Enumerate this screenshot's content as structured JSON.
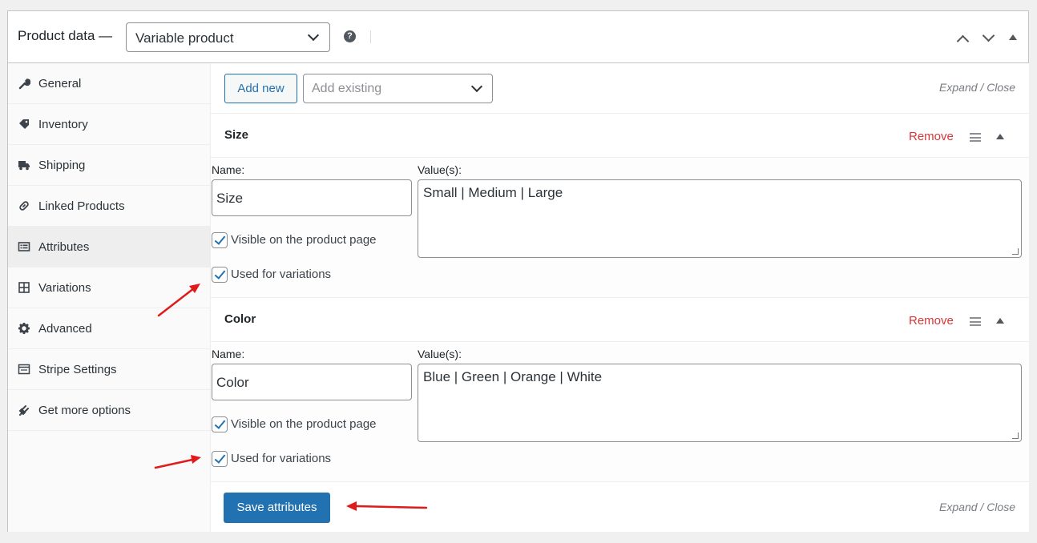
{
  "header": {
    "title": "Product data —",
    "product_type": "Variable product"
  },
  "sidebar": {
    "items": [
      {
        "label": "General",
        "icon": "wrench-icon"
      },
      {
        "label": "Inventory",
        "icon": "tag-icon"
      },
      {
        "label": "Shipping",
        "icon": "truck-icon"
      },
      {
        "label": "Linked Products",
        "icon": "link-icon"
      },
      {
        "label": "Attributes",
        "icon": "list-icon",
        "active": true
      },
      {
        "label": "Variations",
        "icon": "grid-icon"
      },
      {
        "label": "Advanced",
        "icon": "gear-icon"
      },
      {
        "label": "Stripe Settings",
        "icon": "window-icon"
      },
      {
        "label": "Get more options",
        "icon": "plug-icon"
      }
    ]
  },
  "toolbar": {
    "add_new": "Add new",
    "add_existing_placeholder": "Add existing",
    "expand_close": "Expand / Close"
  },
  "attributes": [
    {
      "title": "Size",
      "remove": "Remove",
      "name_label": "Name:",
      "values_label": "Value(s):",
      "name": "Size",
      "values": "Small | Medium | Large",
      "visible_label": "Visible on the product page",
      "visible": true,
      "variations_label": "Used for variations",
      "variations": true
    },
    {
      "title": "Color",
      "remove": "Remove",
      "name_label": "Name:",
      "values_label": "Value(s):",
      "name": "Color",
      "values": "Blue | Green | Orange | White",
      "visible_label": "Visible on the product page",
      "visible": true,
      "variations_label": "Used for variations",
      "variations": true
    }
  ],
  "footer": {
    "save": "Save attributes",
    "expand_close": "Expand / Close"
  },
  "colors": {
    "accent": "#2271b1",
    "remove": "#d63638",
    "annotation_arrow": "#e01b1b"
  }
}
